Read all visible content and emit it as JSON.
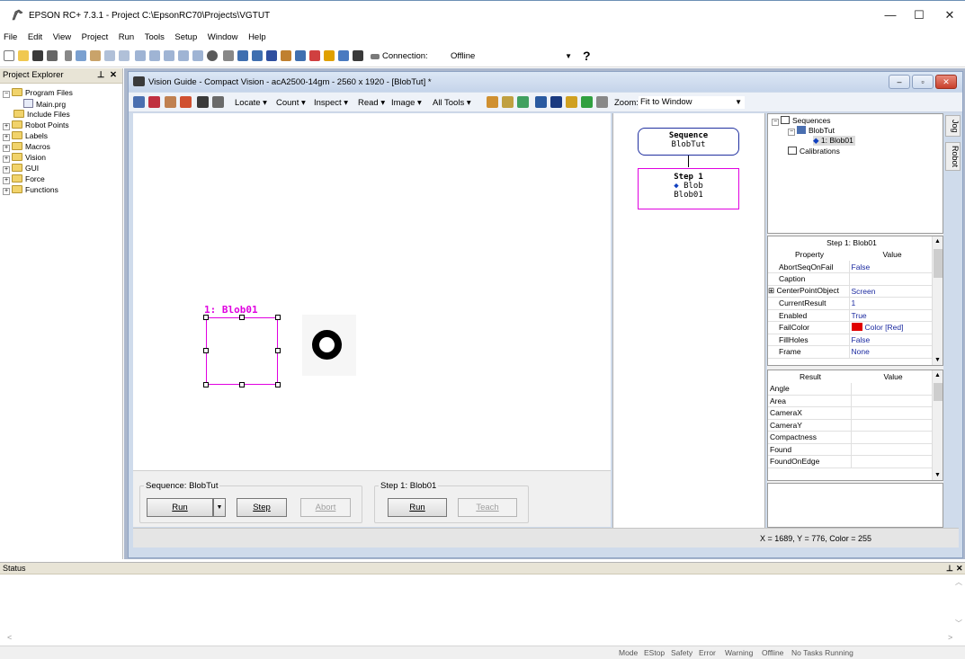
{
  "window": {
    "title": "EPSON RC+ 7.3.1 - Project C:\\EpsonRC70\\Projects\\VGTUT",
    "minimize": "—",
    "maximize": "☐",
    "close": "✕"
  },
  "menu": [
    "File",
    "Edit",
    "View",
    "Project",
    "Run",
    "Tools",
    "Setup",
    "Window",
    "Help"
  ],
  "toolbar": {
    "connection_label": "Connection:",
    "connection_value": "Offline",
    "help": "?"
  },
  "project_explorer": {
    "title": "Project Explorer",
    "pin": "⊥",
    "close": "✕",
    "items": [
      "Program Files",
      "Main.prg",
      "Include Files",
      "Robot Points",
      "Labels",
      "Macros",
      "Vision",
      "GUI",
      "Force",
      "Functions"
    ]
  },
  "vision_guide": {
    "title": "Vision Guide - Compact Vision - acA2500-14gm - 2560 x 1920 - [BlobTut] *",
    "menus": [
      "Locate",
      "Count",
      "Inspect",
      "Read",
      "Image",
      "All Tools"
    ],
    "zoom_label": "Zoom:",
    "zoom_value": "Fit to Window",
    "blob_label": "1: Blob01",
    "flow": {
      "seq_title": "Sequence",
      "seq_name": "BlobTut",
      "step_title": "Step 1",
      "step_type": "Blob",
      "step_name": "Blob01"
    },
    "tree": {
      "sequences": "Sequences",
      "seq": "BlobTut",
      "step": "1: Blob01",
      "calibrations": "Calibrations"
    },
    "side_tabs": [
      "Jog",
      "Robot"
    ],
    "property_grid": {
      "title": "Step 1: Blob01",
      "col_property": "Property",
      "col_value": "Value",
      "rows": [
        {
          "name": "AbortSeqOnFail",
          "value": "False"
        },
        {
          "name": "Caption",
          "value": ""
        },
        {
          "name": "CenterPointObject",
          "value": "Screen"
        },
        {
          "name": "CurrentResult",
          "value": "1"
        },
        {
          "name": "Enabled",
          "value": "True"
        },
        {
          "name": "FailColor",
          "value": "Color [Red]"
        },
        {
          "name": "FillHoles",
          "value": "False"
        },
        {
          "name": "Frame",
          "value": "None"
        }
      ],
      "expand": "⊞"
    },
    "result_grid": {
      "col_result": "Result",
      "col_value": "Value",
      "rows": [
        "Angle",
        "Area",
        "CameraX",
        "CameraY",
        "Compactness",
        "Found",
        "FoundOnEdge"
      ]
    },
    "sequence_group": {
      "label": "Sequence: BlobTut",
      "run": "Run",
      "step": "Step",
      "abort": "Abort"
    },
    "step_group": {
      "label": "Step 1: Blob01",
      "run": "Run",
      "teach": "Teach"
    },
    "coords": "X = 1689, Y = 776, Color = 255"
  },
  "status_panel": {
    "title": "Status"
  },
  "status_bar": [
    "Mode",
    "EStop",
    "Safety",
    "Error",
    "Warning",
    "Offline",
    "No Tasks Running"
  ],
  "colors": {
    "blob_magenta": "#e000e0",
    "fail_red": "#e00000",
    "value_blue": "#1b2aa0"
  }
}
